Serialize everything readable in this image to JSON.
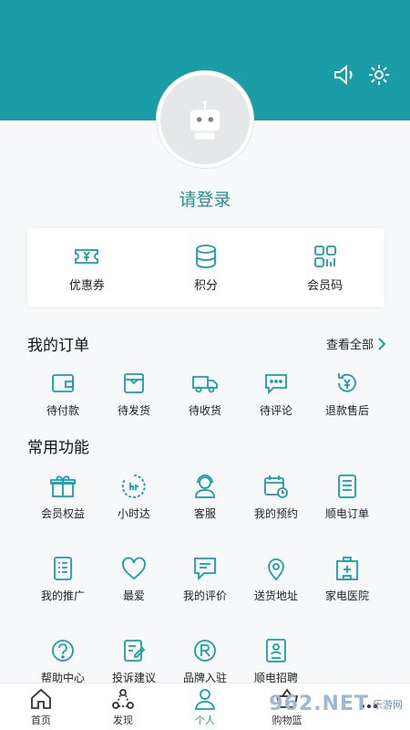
{
  "header": {
    "sound_icon": "speaker-icon",
    "settings_icon": "gear-icon"
  },
  "profile": {
    "login_label": "请登录"
  },
  "quick": {
    "coupon": "优惠券",
    "points": "积分",
    "member_code": "会员码"
  },
  "orders": {
    "title": "我的订单",
    "see_all": "查看全部",
    "items": [
      "待付款",
      "待发货",
      "待收货",
      "待评论",
      "退款售后"
    ]
  },
  "functions": {
    "title": "常用功能",
    "row1": [
      "会员权益",
      "小时达",
      "客服",
      "我的预约",
      "顺电订单"
    ],
    "row2": [
      "我的推广",
      "最爱",
      "我的评价",
      "送货地址",
      "家电医院"
    ],
    "row3": [
      "帮助中心",
      "投诉建议",
      "品牌入驻",
      "顺电招聘"
    ]
  },
  "tabbar": {
    "home": "首页",
    "discover": "发现",
    "me": "个人",
    "cart": "购物篮"
  },
  "watermark": {
    "text": "962.NET",
    "sub": "乐游网"
  },
  "colors": {
    "accent": "#1a9da6"
  }
}
